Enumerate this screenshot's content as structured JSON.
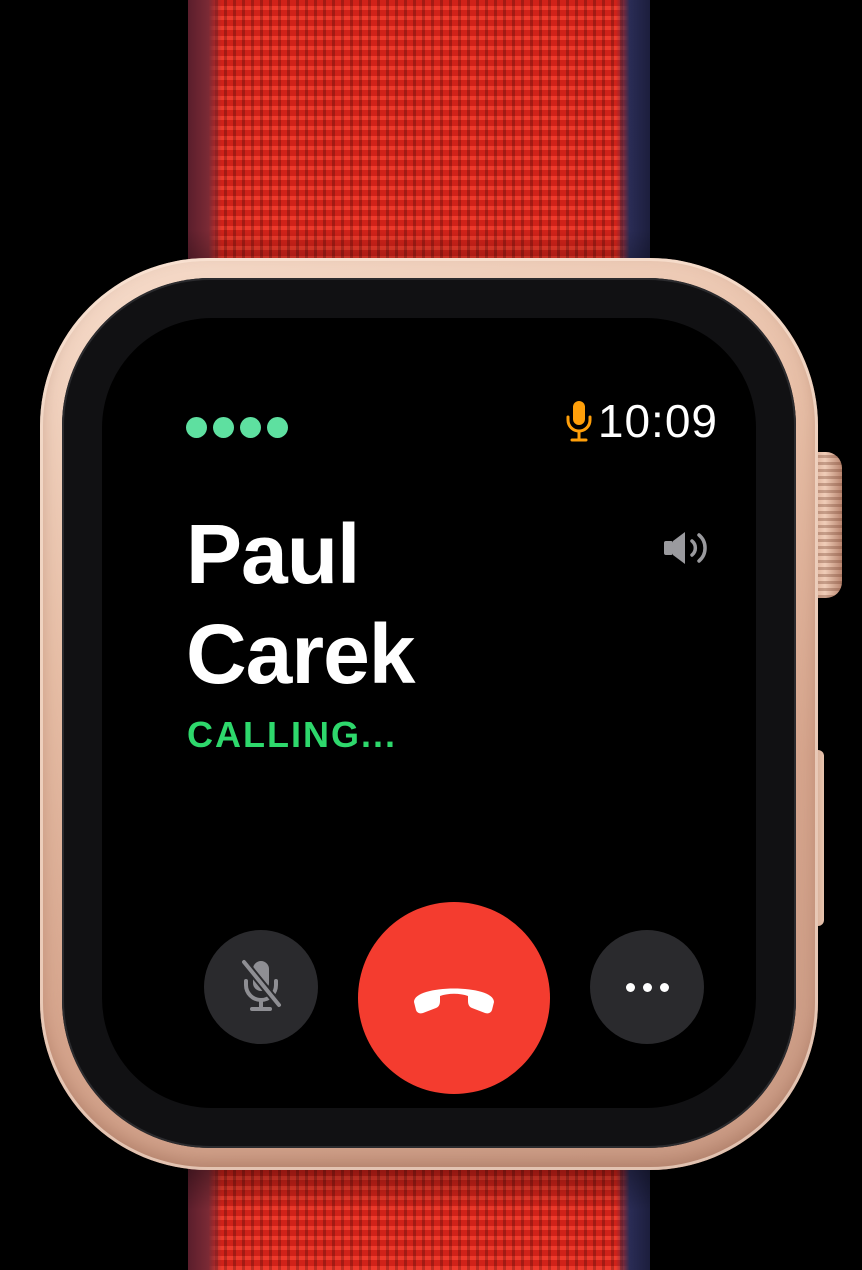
{
  "status_bar": {
    "signal_dots": [
      1,
      2,
      3,
      4
    ],
    "time": "10:09",
    "mic_indicator_icon": "mic-icon",
    "mic_indicator_color": "#ff9f0a",
    "signal_color": "#5ee0a0"
  },
  "call": {
    "caller_first": "Paul",
    "caller_last": "Carek",
    "status": "CALLING...",
    "status_color": "#2ed86c",
    "speaker_icon": "speaker-volume-icon"
  },
  "controls": {
    "mute_icon": "mic-muted-icon",
    "end_call_icon": "phone-hangup-icon",
    "end_call_color": "#f43c2f",
    "more_icon": "ellipsis-icon"
  },
  "hardware": {
    "band_color": "#e8261c",
    "case_color": "#e7bea6"
  }
}
